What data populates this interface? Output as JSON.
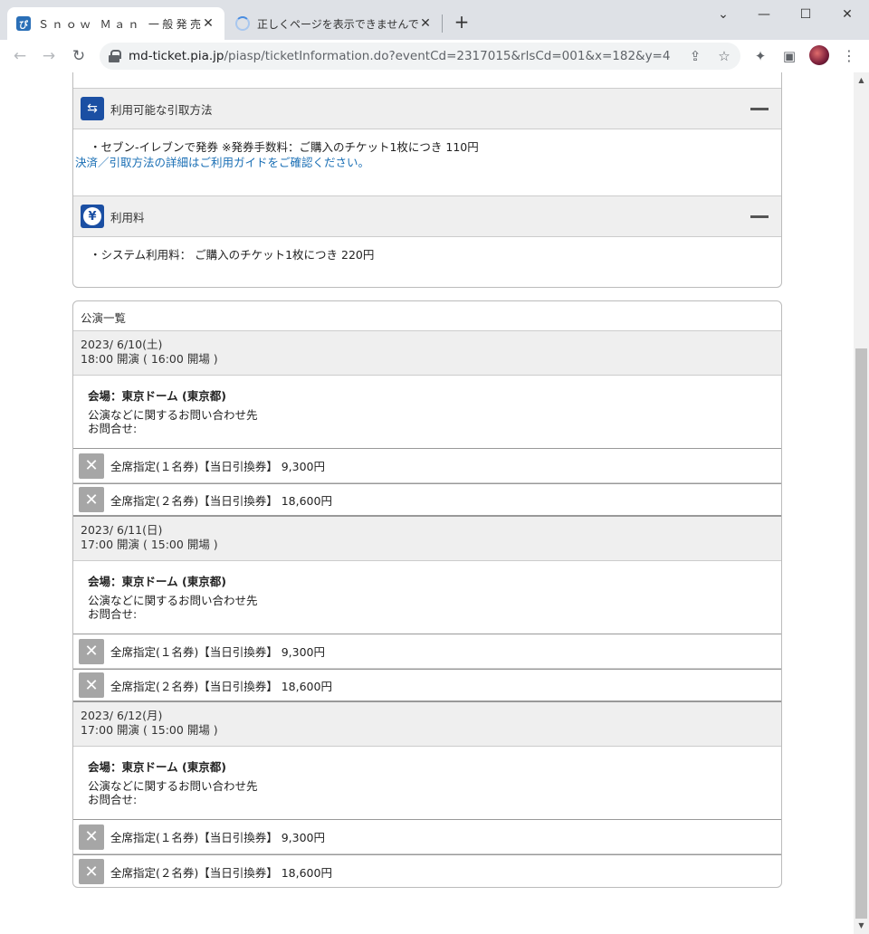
{
  "browser": {
    "tabs": [
      {
        "title": "Ｓｎｏｗ Ｍａｎ 一般発売（東",
        "favicon": "pia-icon",
        "close": "✕"
      },
      {
        "title": "正しくページを表示できませんでした。",
        "favicon": "loading-icon",
        "close": "✕"
      }
    ],
    "new_tab": "+",
    "window_controls": {
      "minimize": "⌄",
      "min2": "—",
      "max": "☐",
      "close": "✕"
    },
    "url_host": "md-ticket.pia.jp",
    "url_path": "/piasp/ticketInformation.do?eventCd=2317015&rlsCd=001&x=182&y=4"
  },
  "sections": [
    {
      "title": "利用可能な引取方法",
      "icon": "transfer-icon",
      "lines": [
        "・セブン-イレブンで発券 ※発券手数料：ご購入のチケット1枚につき 110円"
      ],
      "link": "決済／引取方法の詳細はご利用ガイドをご確認ください。"
    },
    {
      "title": "利用料",
      "icon": "yen-icon",
      "lines": [
        "・システム利用料： ご購入のチケット1枚につき 220円"
      ]
    }
  ],
  "performances": {
    "title": "公演一覧",
    "items": [
      {
        "date": "2023/ 6/10(土)",
        "time": "18:00 開演 ( 16:00 開場 )",
        "venue": "会場：東京ドーム (東京都)",
        "contact": "公演などに関するお問い合わせ先",
        "inquiry": "お問合せ:",
        "tickets": [
          "全席指定(１名券)【当日引換券】 9,300円",
          "全席指定(２名券)【当日引換券】 18,600円"
        ]
      },
      {
        "date": "2023/ 6/11(日)",
        "time": "17:00 開演 ( 15:00 開場 )",
        "venue": "会場：東京ドーム (東京都)",
        "contact": "公演などに関するお問い合わせ先",
        "inquiry": "お問合せ:",
        "tickets": [
          "全席指定(１名券)【当日引換券】 9,300円",
          "全席指定(２名券)【当日引換券】 18,600円"
        ]
      },
      {
        "date": "2023/ 6/12(月)",
        "time": "17:00 開演 ( 15:00 開場 )",
        "venue": "会場：東京ドーム (東京都)",
        "contact": "公演などに関するお問い合わせ先",
        "inquiry": "お問合せ:",
        "tickets": [
          "全席指定(１名券)【当日引換券】 9,300円",
          "全席指定(２名券)【当日引換券】 18,600円"
        ]
      }
    ]
  },
  "colors": {
    "accent": "#1b4fa3",
    "link": "#1a6fb5",
    "header_bg": "#efefef",
    "soldout": "#a6a6a6"
  }
}
